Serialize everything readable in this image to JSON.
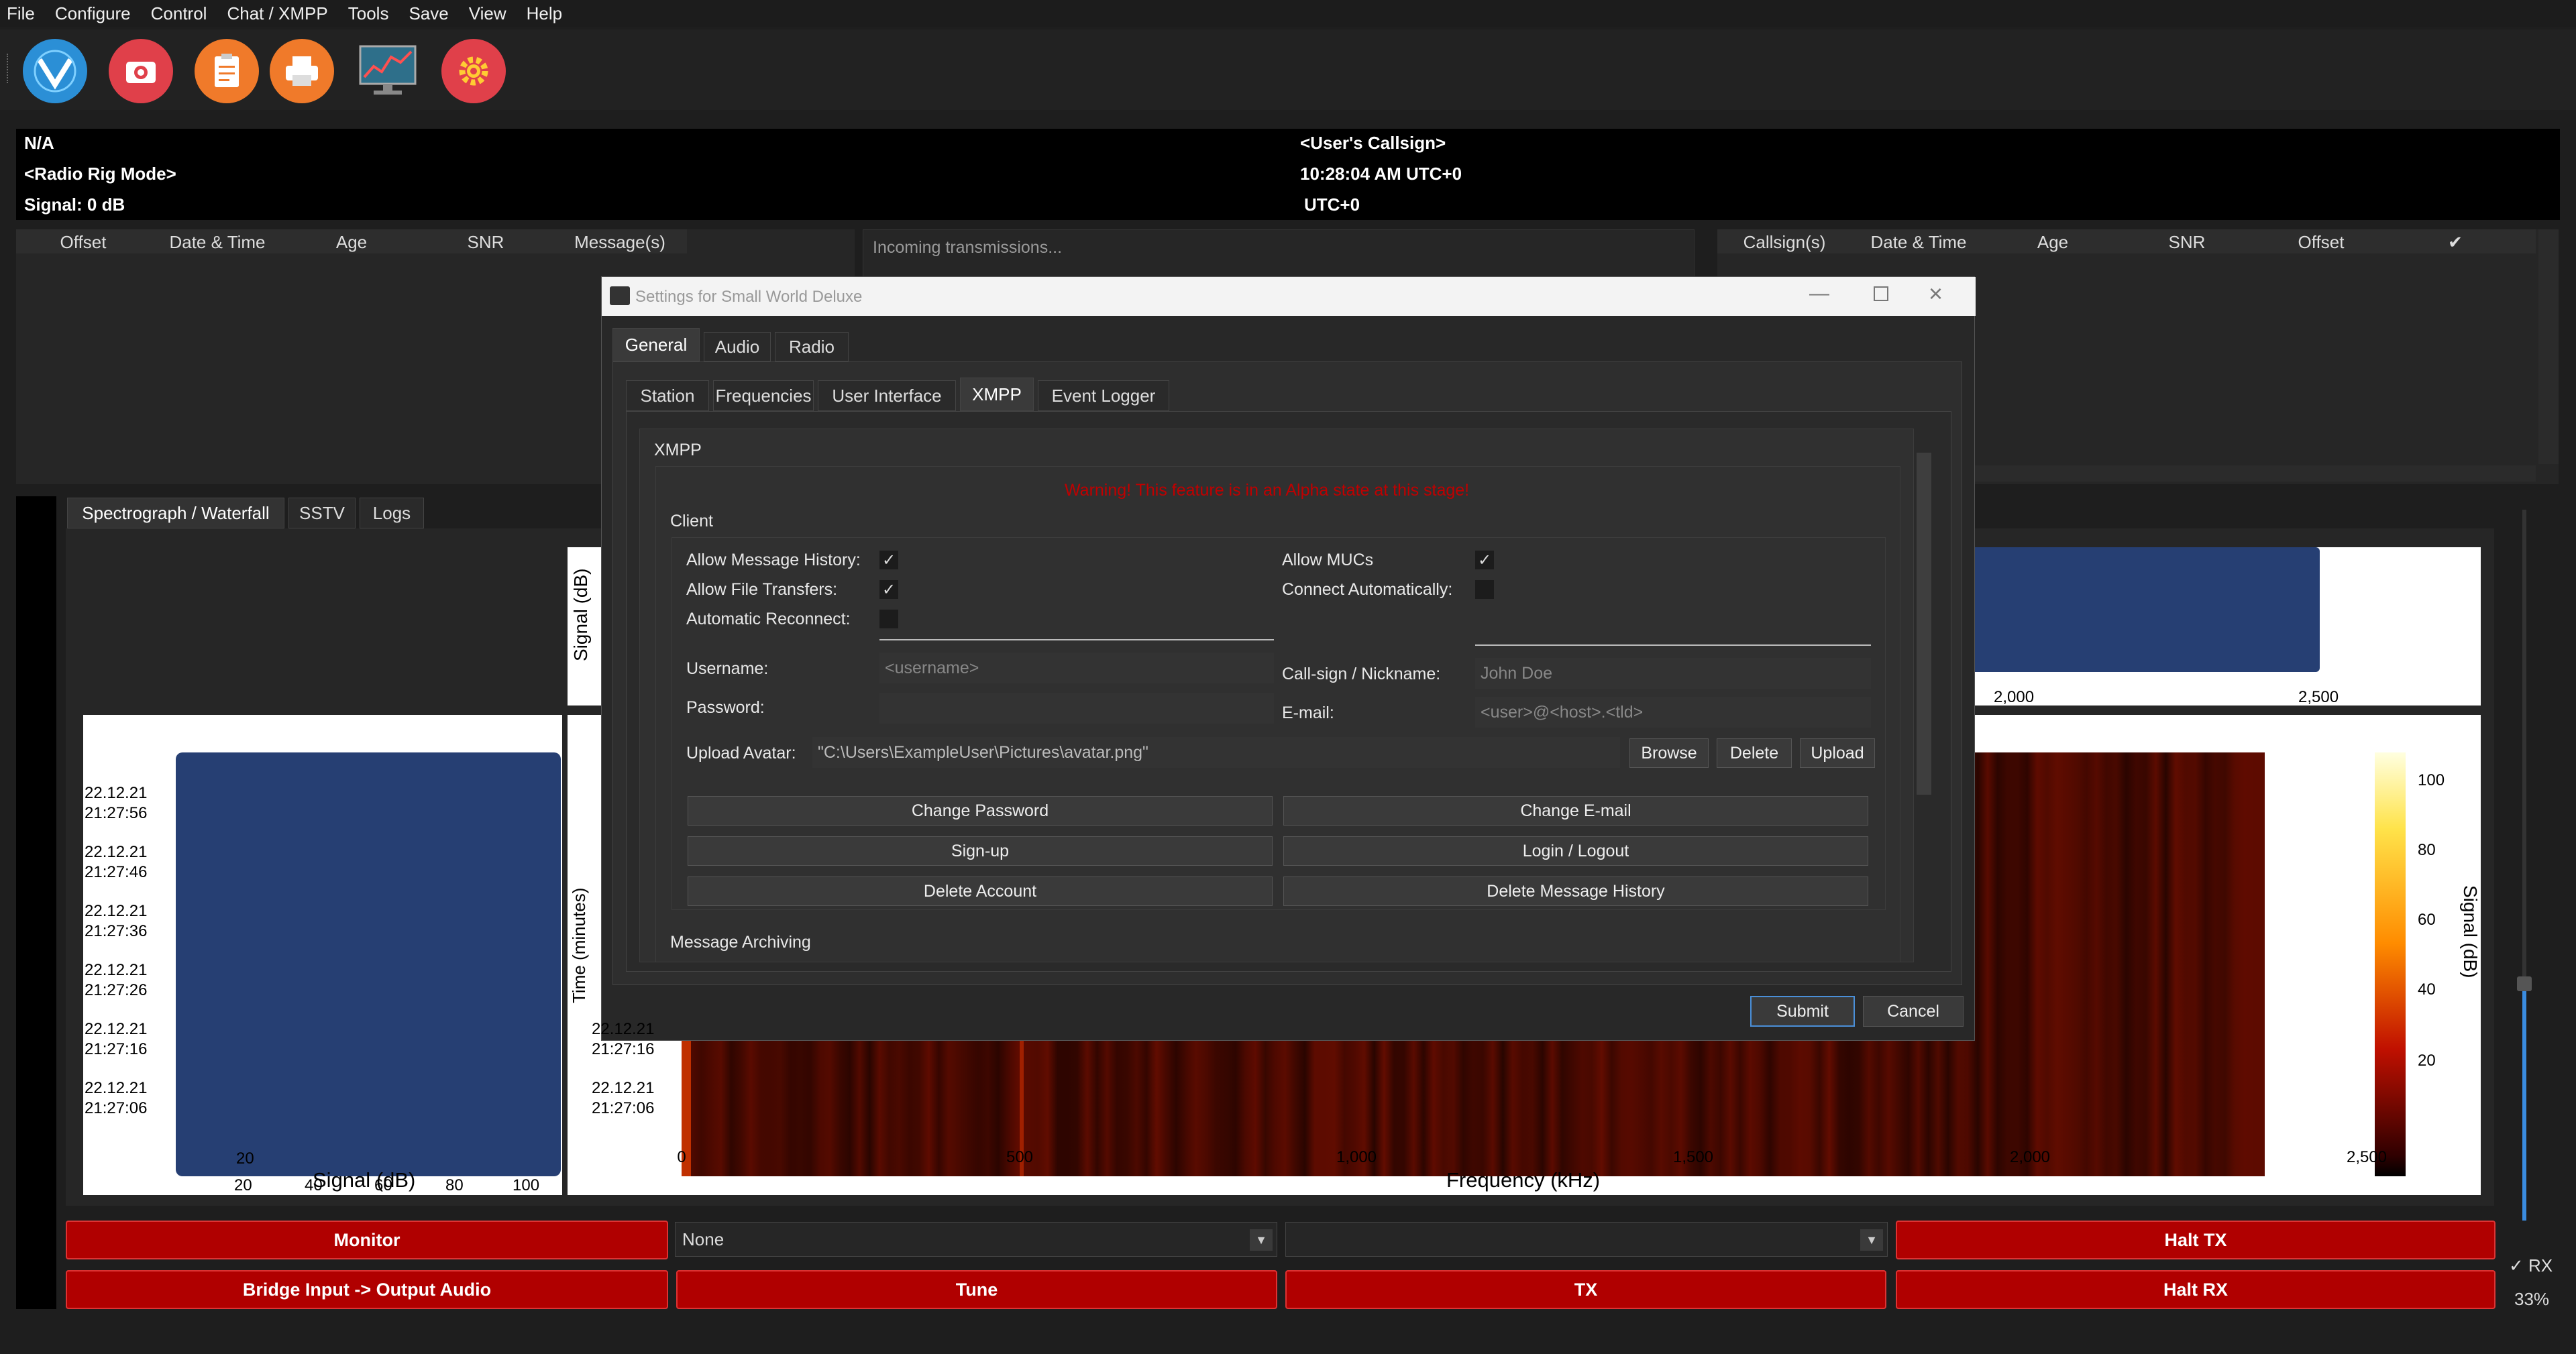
{
  "menu": [
    "File",
    "Configure",
    "Control",
    "Chat / XMPP",
    "Tools",
    "Save",
    "View",
    "Help"
  ],
  "toolbar": {
    "icons": [
      "app-logo-icon",
      "camera-icon",
      "clipboard-icon",
      "printer-icon",
      "monitor-chart-icon",
      "settings-gear-icon"
    ]
  },
  "info": {
    "left1": "N/A",
    "left2": "<Radio Rig Mode>",
    "left3": "Signal: 0 dB",
    "right1": "<User's Callsign>",
    "right2": "10:28:04 AM UTC+0",
    "right3": "UTC+0"
  },
  "left_table": {
    "headers": [
      "Offset",
      "Date & Time",
      "Age",
      "SNR",
      "Message(s)"
    ]
  },
  "incoming": {
    "placeholder": "Incoming transmissions..."
  },
  "right_table": {
    "headers": [
      "Callsign(s)",
      "Date & Time",
      "Age",
      "SNR",
      "Offset",
      "✔"
    ]
  },
  "main_tabs": [
    "Spectrograph / Waterfall",
    "SSTV",
    "Logs"
  ],
  "charts": {
    "signal_ylabel": "Signal (dB)",
    "histogram_xlabel": "Signal (dB)",
    "histogram_xticks": [
      "20",
      "40",
      "60",
      "80",
      "100"
    ],
    "timestamps": [
      [
        "22.12.21",
        "21:27:56"
      ],
      [
        "22.12.21",
        "21:27:46"
      ],
      [
        "22.12.21",
        "21:27:36"
      ],
      [
        "22.12.21",
        "21:27:26"
      ],
      [
        "22.12.21",
        "21:27:16"
      ],
      [
        "22.12.21",
        "21:27:06"
      ]
    ],
    "waterfall_ylabel": "Time (minutes)",
    "waterfall_xlabel": "Frequency (kHz)",
    "freq_ticks": [
      "0",
      "500",
      "1,000",
      "1,500",
      "2,000",
      "2,500"
    ],
    "top_ticks": [
      "2,000",
      "2,500"
    ],
    "colorbar_ticks": [
      "100",
      "80",
      "60",
      "40",
      "20"
    ],
    "colorbar_label": "Signal (dB)"
  },
  "chart_data": {
    "type": "heatmap",
    "xlabel": "Frequency (kHz)",
    "ylabel": "Time (minutes)",
    "xlim": [
      0,
      2500
    ],
    "x_ticks": [
      0,
      500,
      1000,
      1500,
      2000,
      2500
    ],
    "y_tick_labels": [
      "22.12.21 21:27:56",
      "22.12.21 21:27:46",
      "22.12.21 21:27:36",
      "22.12.21 21:27:26",
      "22.12.21 21:27:16",
      "22.12.21 21:27:06"
    ],
    "colorbar": {
      "label": "Signal (dB)",
      "ticks": [
        20,
        40,
        60,
        80,
        100
      ]
    }
  },
  "bottom": {
    "monitor": "Monitor",
    "bridge": "Bridge Input -> Output Audio",
    "combo1": "None",
    "combo2": "",
    "tune": "Tune",
    "tx": "TX",
    "halt_tx": "Halt TX",
    "halt_rx": "Halt RX",
    "rx_label": "RX",
    "volume": "33%"
  },
  "dialog": {
    "title": "Settings for Small World Deluxe",
    "top_tabs": [
      "General",
      "Audio",
      "Radio"
    ],
    "sub_tabs": [
      "Station",
      "Frequencies",
      "User Interface",
      "XMPP",
      "Event Logger"
    ],
    "group": "XMPP",
    "warning": "Warning! This feature is in an Alpha state at this stage!",
    "client": "Client",
    "allow_history": "Allow Message History:",
    "allow_files": "Allow File Transfers:",
    "auto_reconnect": "Automatic Reconnect:",
    "allow_mucs": "Allow MUCs",
    "connect_auto": "Connect Automatically:",
    "username_label": "Username:",
    "username_placeholder": "<username>",
    "password_label": "Password:",
    "callsign_label": "Call-sign / Nickname:",
    "callsign_placeholder": "John Doe",
    "email_label": "E-mail:",
    "email_placeholder": "<user>@<host>.<tld>",
    "avatar_label": "Upload Avatar:",
    "avatar_path": "\"C:\\Users\\ExampleUser\\Pictures\\avatar.png\"",
    "browse": "Browse",
    "delete": "Delete",
    "upload": "Upload",
    "change_password": "Change Password",
    "change_email": "Change E-mail",
    "signup": "Sign-up",
    "login_logout": "Login / Logout",
    "delete_account": "Delete Account",
    "delete_history": "Delete Message History",
    "archiving": "Message Archiving",
    "submit": "Submit",
    "cancel": "Cancel"
  },
  "colors": {
    "accent": "#b00000",
    "plot_blue": "#263f73",
    "submit_border": "#4a8fd8"
  }
}
